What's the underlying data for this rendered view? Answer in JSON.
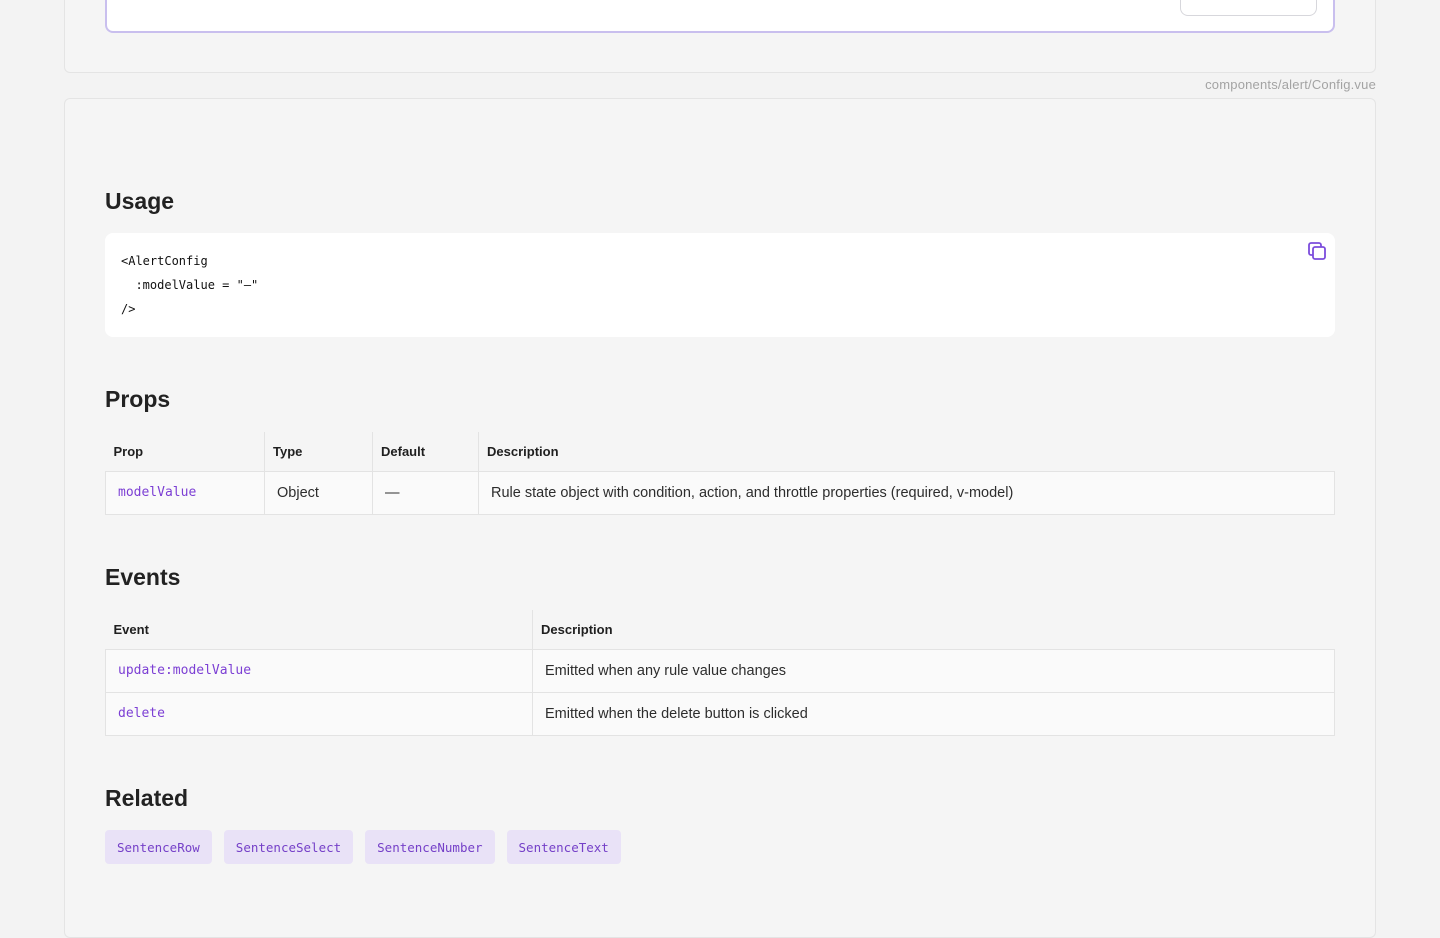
{
  "file_path": "components/alert/Config.vue",
  "sections": {
    "usage": "Usage",
    "props": "Props",
    "events": "Events",
    "related": "Related"
  },
  "usage_code": {
    "lines": [
      "<AlertConfig",
      "  :modelValue = \"—\"",
      "/>"
    ],
    "copy_icon": "copy-icon"
  },
  "props_table": {
    "headers": {
      "prop": "Prop",
      "type": "Type",
      "default": "Default",
      "description": "Description"
    },
    "rows": [
      {
        "prop": "modelValue",
        "type": "Object",
        "default": "—",
        "description": "Rule state object with condition, action, and throttle properties (required, v-model)"
      }
    ]
  },
  "events_table": {
    "headers": {
      "event": "Event",
      "description": "Description"
    },
    "rows": [
      {
        "event": "update:modelValue",
        "description": "Emitted when any rule value changes"
      },
      {
        "event": "delete",
        "description": "Emitted when the delete button is clicked"
      }
    ]
  },
  "related": [
    "SentenceRow",
    "SentenceSelect",
    "SentenceNumber",
    "SentenceText"
  ],
  "colors": {
    "accent": "#7c3fd4",
    "chip_bg": "#e9e2f7",
    "card_bg": "#f5f5f5"
  }
}
